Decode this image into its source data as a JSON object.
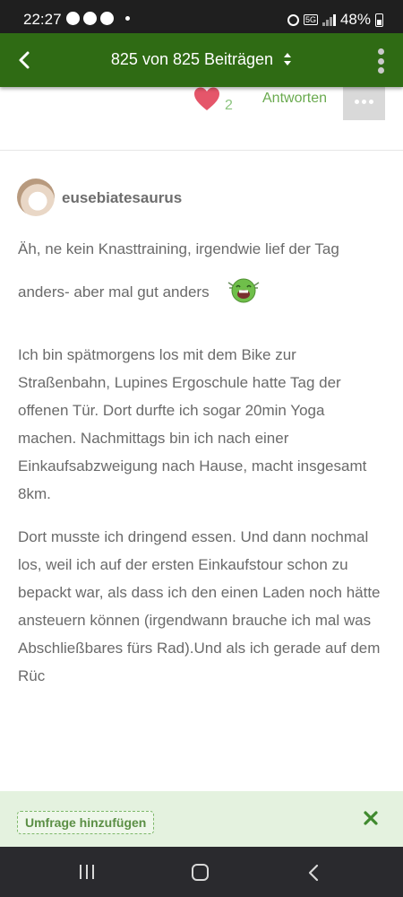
{
  "status_bar": {
    "time": "22:27",
    "battery": "48%",
    "network": "5G"
  },
  "header": {
    "title": "825 von 825 Beiträgen",
    "back_icon": "chevron-left-icon",
    "menu_icon": "kebab-menu-icon",
    "background": "#2f6b14"
  },
  "previous_post": {
    "like_count": "2",
    "reply_label": "Antworten"
  },
  "post": {
    "username": "eusebiatesaurus",
    "line1": "Äh, ne kein Knasttraining, irgendwie lief der Tag",
    "line2": "anders- aber mal gut anders",
    "paragraph2": "Ich bin spätmorgens los mit dem Bike zur Straßenbahn, Lupines Ergoschule hatte Tag der offenen Tür. Dort durfte ich sogar 20min Yoga machen. Nachmittags bin ich nach einer Einkaufsabzweigung nach Hause, macht insgesamt 8km.",
    "paragraph3": "Dort musste ich dringend essen. Und dann nochmal los, weil ich auf der ersten Einkaufstour schon zu bepackt war, als dass ich den einen Laden noch hätte ansteuern können (irgendwann brauche ich mal was Abschließbares fürs Rad).Und als ich gerade auf dem Rüc"
  },
  "compose_bar": {
    "poll_button": "Umfrage hinzufügen",
    "close_icon": "close-icon"
  }
}
